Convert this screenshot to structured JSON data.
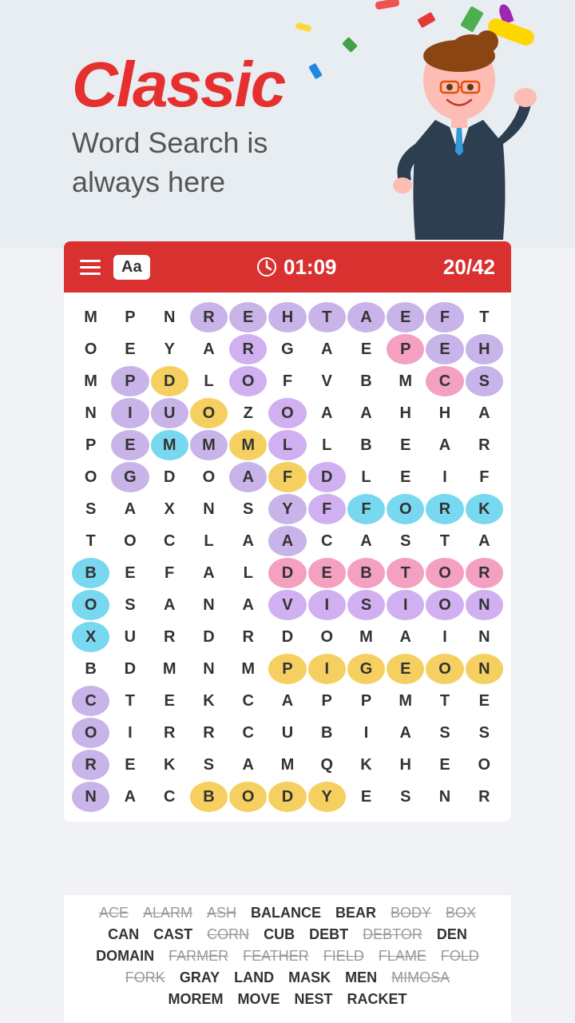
{
  "header": {
    "title": "Classic",
    "subtitle_line1": "Word Search is",
    "subtitle_line2": "always here"
  },
  "toolbar": {
    "timer": "01:09",
    "score": "20/42",
    "aa_label": "Aa"
  },
  "grid": {
    "rows": [
      [
        "M",
        "P",
        "N",
        "R",
        "E",
        "H",
        "T",
        "A",
        "E",
        "F",
        "T"
      ],
      [
        "O",
        "E",
        "Y",
        "A",
        "R",
        "G",
        "A",
        "E",
        "P",
        "E",
        "H"
      ],
      [
        "M",
        "P",
        "D",
        "L",
        "O",
        "F",
        "V",
        "B",
        "M",
        "C",
        "S"
      ],
      [
        "N",
        "I",
        "U",
        "O",
        "Z",
        "O",
        "A",
        "A",
        "H",
        "H",
        "A"
      ],
      [
        "P",
        "E",
        "M",
        "M",
        "M",
        "L",
        "L",
        "B",
        "E",
        "A",
        "R"
      ],
      [
        "O",
        "G",
        "D",
        "O",
        "A",
        "F",
        "D",
        "L",
        "E",
        "I",
        "F"
      ],
      [
        "S",
        "A",
        "X",
        "N",
        "S",
        "Y",
        "F",
        "F",
        "O",
        "R",
        "K"
      ],
      [
        "T",
        "O",
        "C",
        "L",
        "A",
        "A",
        "C",
        "A",
        "S",
        "T",
        "A"
      ],
      [
        "B",
        "E",
        "F",
        "A",
        "L",
        "D",
        "E",
        "B",
        "T",
        "O",
        "R"
      ],
      [
        "O",
        "S",
        "A",
        "N",
        "A",
        "V",
        "I",
        "S",
        "I",
        "O",
        "N"
      ],
      [
        "X",
        "U",
        "R",
        "D",
        "R",
        "D",
        "O",
        "M",
        "A",
        "I",
        "N"
      ],
      [
        "B",
        "D",
        "M",
        "N",
        "M",
        "P",
        "I",
        "G",
        "E",
        "O",
        "N"
      ],
      [
        "C",
        "T",
        "E",
        "K",
        "C",
        "A",
        "P",
        "P",
        "M",
        "T",
        "E"
      ],
      [
        "O",
        "I",
        "R",
        "R",
        "C",
        "U",
        "B",
        "I",
        "A",
        "S",
        "S"
      ],
      [
        "R",
        "E",
        "K",
        "S",
        "A",
        "M",
        "Q",
        "K",
        "H",
        "E",
        "O"
      ],
      [
        "N",
        "A",
        "C",
        "B",
        "O",
        "D",
        "Y",
        "E",
        "S",
        "N",
        "R"
      ]
    ],
    "highlights": {
      "rehtaef": {
        "cells": [
          [
            0,
            3
          ],
          [
            0,
            4
          ],
          [
            0,
            5
          ],
          [
            0,
            6
          ],
          [
            0,
            7
          ],
          [
            0,
            8
          ],
          [
            0,
            9
          ]
        ],
        "color": "hl-purple"
      },
      "pigeon": {
        "cells": [
          [
            11,
            5
          ],
          [
            11,
            6
          ],
          [
            11,
            7
          ],
          [
            11,
            8
          ],
          [
            11,
            9
          ],
          [
            11,
            10
          ]
        ],
        "color": "hl-yellow"
      },
      "vision": {
        "cells": [
          [
            9,
            5
          ],
          [
            9,
            6
          ],
          [
            9,
            7
          ],
          [
            9,
            8
          ],
          [
            9,
            9
          ],
          [
            9,
            10
          ]
        ],
        "color": "hl-lavender"
      },
      "debtor": {
        "cells": [
          [
            8,
            5
          ],
          [
            8,
            6
          ],
          [
            8,
            7
          ],
          [
            8,
            8
          ],
          [
            8,
            9
          ],
          [
            8,
            10
          ]
        ],
        "color": "hl-pink"
      },
      "fork": {
        "cells": [
          [
            6,
            7
          ],
          [
            6,
            8
          ],
          [
            6,
            9
          ],
          [
            6,
            10
          ]
        ],
        "color": "hl-cyan"
      },
      "body": {
        "cells": [
          [
            15,
            3
          ],
          [
            15,
            4
          ],
          [
            15,
            5
          ],
          [
            15,
            6
          ]
        ],
        "color": "hl-yellow"
      },
      "box": {
        "cells": [
          [
            8,
            0
          ],
          [
            9,
            0
          ],
          [
            10,
            0
          ]
        ],
        "color": "hl-cyan"
      },
      "pale": {
        "cells": [
          [
            2,
            1
          ],
          [
            3,
            1
          ],
          [
            4,
            1
          ],
          [
            5,
            1
          ]
        ],
        "color": "hl-purple"
      }
    }
  },
  "word_list": {
    "rows": [
      [
        {
          "text": "ACE",
          "done": true
        },
        {
          "text": "ALARM",
          "done": true
        },
        {
          "text": "ASH",
          "done": true
        },
        {
          "text": "BALANCE",
          "done": false
        },
        {
          "text": "BEAR",
          "done": false
        },
        {
          "text": "BODY",
          "done": true
        },
        {
          "text": "BOX",
          "done": true
        }
      ],
      [
        {
          "text": "CAN",
          "done": false
        },
        {
          "text": "CAST",
          "done": false
        },
        {
          "text": "CORN",
          "done": true
        },
        {
          "text": "CUB",
          "done": false
        },
        {
          "text": "DEBT",
          "done": false
        },
        {
          "text": "DEBTOR",
          "done": true
        },
        {
          "text": "DEN",
          "done": false
        }
      ],
      [
        {
          "text": "DOMAIN",
          "done": false
        },
        {
          "text": "FARMER",
          "done": true
        },
        {
          "text": "FEATHER",
          "done": true
        },
        {
          "text": "FIELD",
          "done": true
        },
        {
          "text": "FLAME",
          "done": true
        },
        {
          "text": "FOLD",
          "done": true
        }
      ],
      [
        {
          "text": "FORK",
          "done": true
        },
        {
          "text": "GRAY",
          "done": false
        },
        {
          "text": "LAND",
          "done": false
        },
        {
          "text": "MASK",
          "done": false
        },
        {
          "text": "MEN",
          "done": false
        },
        {
          "text": "MIMOSA",
          "done": true
        }
      ],
      [
        {
          "text": "MOREM",
          "done": false
        },
        {
          "text": "MOVE",
          "done": false
        },
        {
          "text": "NEST",
          "done": false
        },
        {
          "text": "RACKET",
          "done": false
        }
      ]
    ]
  }
}
